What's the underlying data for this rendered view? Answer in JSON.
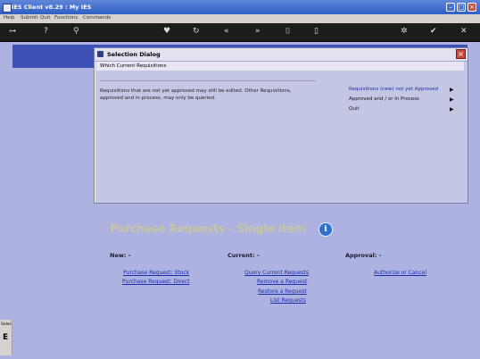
{
  "window": {
    "title": "IES Client v8.29 : My IES"
  },
  "menu": [
    "Help",
    "Submit",
    "Quit",
    "Functions",
    "Commands"
  ],
  "toolbar": {
    "icons": [
      "key-icon",
      "help-icon",
      "search-icon",
      "heart-icon",
      "refresh-icon",
      "back-icon",
      "forward-icon",
      "bookmark-icon",
      "page-icon",
      "settings-icon",
      "check-icon",
      "close-icon"
    ]
  },
  "dialog": {
    "title": "Selection Dialog",
    "subtitle": "Which Current Requisitions",
    "message": "Requisitions that are not yet approved may still be edited. Other Requisitions, approved and in process, may only be queried.",
    "options": [
      {
        "label": "Requisitions (new) not yet Approved",
        "selected": true
      },
      {
        "label": "Approved and / or In Process",
        "selected": false
      },
      {
        "label": "Quit",
        "selected": false
      }
    ]
  },
  "page": {
    "title": "Purchase Requests - Single Item",
    "info_icon": "i",
    "sections": {
      "new": {
        "heading": "New: -",
        "links": [
          "Purchase Request: Stock",
          "Purchase Request: Direct"
        ]
      },
      "current": {
        "heading": "Current: -",
        "links": [
          "Query Current Requests",
          "Remove a Request",
          "Restore a Request",
          "List Requests"
        ]
      },
      "approval": {
        "heading": "Approval: -",
        "links": [
          "Authorize or Cancel"
        ]
      }
    }
  },
  "side": {
    "label": "Selec",
    "letter": "E"
  },
  "colors": {
    "titlebar": "#2f5fc5",
    "background": "#aeb2e0",
    "banner": "#3f50b5",
    "link": "#1a2cb0"
  }
}
